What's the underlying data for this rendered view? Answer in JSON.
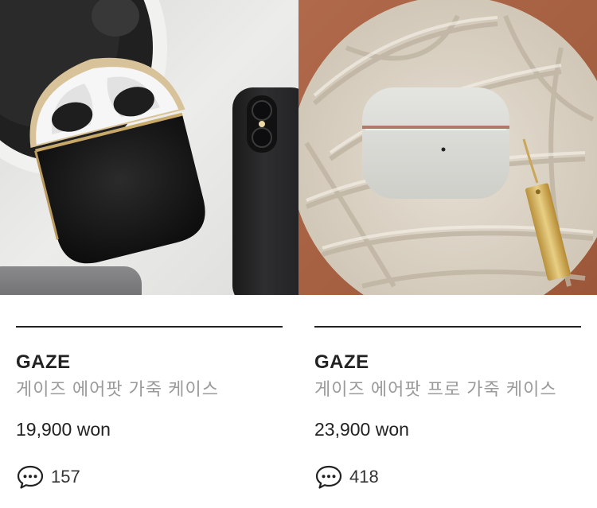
{
  "products": [
    {
      "image": "black-leather-airpods-case-photo",
      "brand": "GAZE",
      "name": "게이즈 에어팟 가죽 케이스",
      "price": "19,900 won",
      "review_icon": "speech-bubble-icon",
      "review_count": "157"
    },
    {
      "image": "white-leather-airpods-pro-case-photo",
      "brand": "GAZE",
      "name": "게이즈 에어팟 프로 가죽 케이스",
      "price": "23,900 won",
      "review_icon": "speech-bubble-icon",
      "review_count": "418"
    }
  ],
  "colors": {
    "text": "#222222",
    "subtext": "#9a9a9a",
    "rule": "#222222"
  }
}
